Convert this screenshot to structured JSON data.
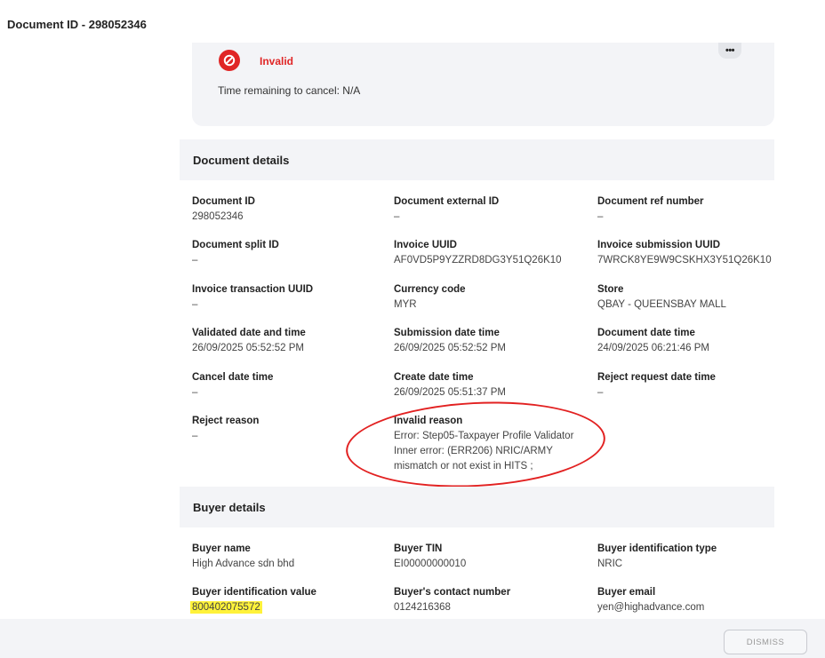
{
  "header": {
    "title": "Document ID - 298052346"
  },
  "status": {
    "label": "Invalid",
    "time_remaining": "Time remaining to cancel: N/A",
    "more_label": "•••",
    "color": "#e02626"
  },
  "document_details": {
    "title": "Document details",
    "fields": [
      {
        "label": "Document ID",
        "value": "298052346"
      },
      {
        "label": "Document external ID",
        "value": "–"
      },
      {
        "label": "Document ref number",
        "value": "–"
      },
      {
        "label": "Document split ID",
        "value": "–"
      },
      {
        "label": "Invoice UUID",
        "value": "AF0VD5P9YZZRD8DG3Y51Q26K10"
      },
      {
        "label": "Invoice submission UUID",
        "value": "7WRCK8YE9W9CSKHX3Y51Q26K10"
      },
      {
        "label": "Invoice transaction UUID",
        "value": "–"
      },
      {
        "label": "Currency code",
        "value": "MYR"
      },
      {
        "label": "Store",
        "value": "QBAY - QUEENSBAY MALL"
      },
      {
        "label": "Validated date and time",
        "value": "26/09/2025 05:52:52 PM"
      },
      {
        "label": "Submission date time",
        "value": "26/09/2025 05:52:52 PM"
      },
      {
        "label": "Document date time",
        "value": "24/09/2025 06:21:46 PM"
      },
      {
        "label": "Cancel date time",
        "value": "–"
      },
      {
        "label": "Create date time",
        "value": "26/09/2025 05:51:37 PM"
      },
      {
        "label": "Reject request date time",
        "value": "–"
      },
      {
        "label": "Reject reason",
        "value": "–"
      },
      {
        "label": "Invalid reason",
        "value": "Error: Step05-Taxpayer Profile Validator\nInner error: (ERR206) NRIC/ARMY\nmismatch or not exist in HITS ;"
      }
    ]
  },
  "buyer_details": {
    "title": "Buyer details",
    "fields": [
      {
        "label": "Buyer name",
        "value": "High Advance sdn bhd"
      },
      {
        "label": "Buyer TIN",
        "value": "EI00000000010"
      },
      {
        "label": "Buyer identification type",
        "value": "NRIC"
      },
      {
        "label": "Buyer identification value",
        "value": "800402075572"
      },
      {
        "label": "Buyer's contact number",
        "value": "0124216368"
      },
      {
        "label": "Buyer email",
        "value": "yen@highadvance.com"
      }
    ]
  },
  "footer": {
    "dismiss_label": "DISMISS"
  },
  "colors": {
    "annotation": "#e22121",
    "highlight": "#fff23a",
    "panel": "#f3f4f7"
  }
}
